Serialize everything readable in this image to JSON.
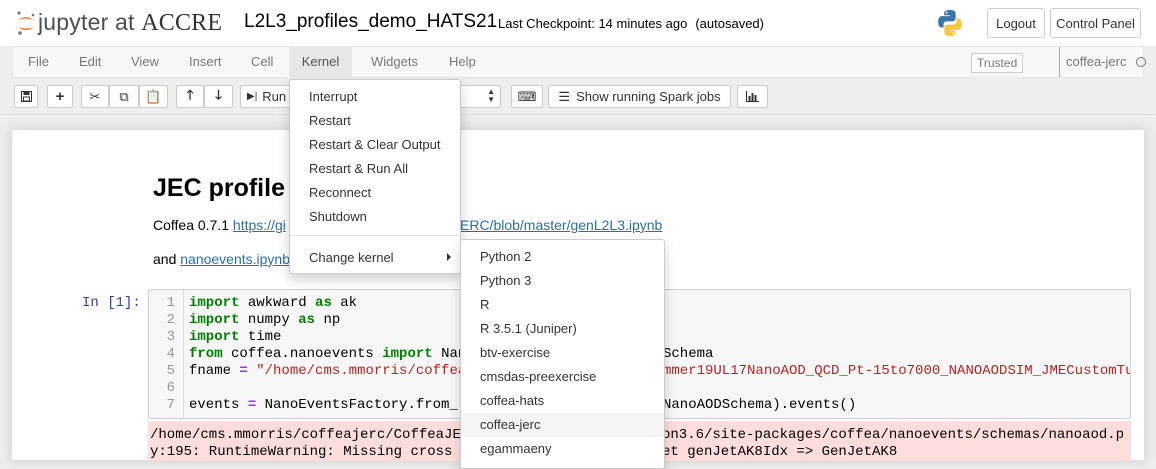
{
  "header": {
    "logo_text": "jupyter at",
    "logo_org": "ACCRE",
    "notebook_title": "L2L3_profiles_demo_HATS21",
    "checkpoint": "Last Checkpoint: 14 minutes ago",
    "autosave": "(autosaved)",
    "logout_label": "Logout",
    "control_panel_label": "Control Panel"
  },
  "menubar": {
    "items": [
      "File",
      "Edit",
      "View",
      "Insert",
      "Cell",
      "Kernel",
      "Widgets",
      "Help"
    ],
    "active": "Kernel",
    "trusted_label": "Trusted",
    "kernel_name": "coffea-jerc"
  },
  "toolbar": {
    "run_label": "Run",
    "spark_label": "Show running Spark jobs"
  },
  "kernel_menu": {
    "items": [
      "Interrupt",
      "Restart",
      "Restart & Clear Output",
      "Restart & Run All",
      "Reconnect",
      "Shutdown"
    ],
    "change_kernel_label": "Change kernel"
  },
  "change_kernel_menu": {
    "items": [
      "Python 2",
      "Python 3",
      "R",
      "R 3.5.1 (Juniper)",
      "btv-exercise",
      "cmsdas-preexercise",
      "coffea-hats",
      "coffea-jerc",
      "egammaeny"
    ],
    "highlighted": "coffea-jerc"
  },
  "markdown": {
    "heading": "JEC profile",
    "p1_prefix": "Coffea 0.7.1 ",
    "p1_link_a": "https://gi",
    "p1_link_b": "ERC/blob/master/genL2L3.ipynb",
    "p2_prefix": "and ",
    "p2_link": "nanoevents.ipynb"
  },
  "code_cell": {
    "prompt": "In [1]:",
    "line_numbers": [
      "1",
      "2",
      "3",
      "4",
      "5",
      "6",
      "7"
    ],
    "lines": [
      {
        "kw": "import",
        "rest": " awkward ",
        "kw2": "as",
        "rest2": " ak"
      },
      {
        "kw": "import",
        "rest": " numpy ",
        "kw2": "as",
        "rest2": " np"
      },
      {
        "kw": "import",
        "rest": " time"
      },
      {
        "kw": "from",
        "rest": " coffea.nanoevents ",
        "kw2": "import",
        "rest2": " Nan",
        "tail": "Schema"
      },
      {
        "rest": "fname ",
        "op": "=",
        "str": " \"/home/cms.mmorris/coffea",
        "tail_str": "mmer19UL17NanoAOD_QCD_Pt-15to7000_NANOAODSIM_JMECustomTu"
      },
      {
        "rest": ""
      },
      {
        "rest": "events ",
        "op": "=",
        "rest2": " NanoEventsFactory.from_",
        "tail": "NanoAODSchema).events()"
      }
    ]
  },
  "error_output": {
    "line1_a": "/home/cms.mmorris/coffeajerc/CoffeaJE",
    "line1_b": "on3.6/site-packages/coffea/nanoevents/schemas/nanoaod.p",
    "line2_a": "y:195: RuntimeWarning: Missing cross",
    "line2_b": "et genJetAK8Idx => GenJetAK8"
  },
  "colors": {
    "link": "#296eaa",
    "prompt": "#303f9f",
    "keyword": "#008000",
    "string": "#ba2121",
    "error_bg": "#ffdddd"
  }
}
